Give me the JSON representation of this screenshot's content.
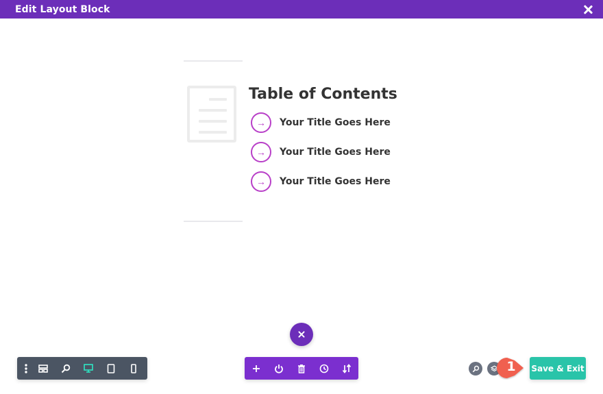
{
  "header": {
    "title": "Edit Layout Block"
  },
  "content": {
    "toc_title": "Table of Contents",
    "items": [
      {
        "label": "Your Title Goes Here"
      },
      {
        "label": "Your Title Goes Here"
      },
      {
        "label": "Your Title Goes Here"
      }
    ],
    "arrow_glyph": "→"
  },
  "toolbar_left": {
    "buttons": [
      "more-options-icon",
      "layout-icon",
      "zoom-icon",
      "desktop-icon",
      "tablet-icon",
      "phone-icon"
    ],
    "active": "desktop-icon"
  },
  "toolbar_center": {
    "buttons": [
      "add-icon",
      "power-icon",
      "trash-icon",
      "history-icon",
      "sort-icon"
    ]
  },
  "annotation": {
    "badge_label": "1"
  },
  "actions": {
    "save_label": "Save & Exit"
  },
  "colors": {
    "header": "#6c2eb9",
    "accent": "#b83fc8",
    "toolbar_left": "#4b5563",
    "toolbar_center": "#7b2fcf",
    "save": "#29c4a9",
    "badge": "#f0614f",
    "active_icon": "#2ee6c4"
  }
}
